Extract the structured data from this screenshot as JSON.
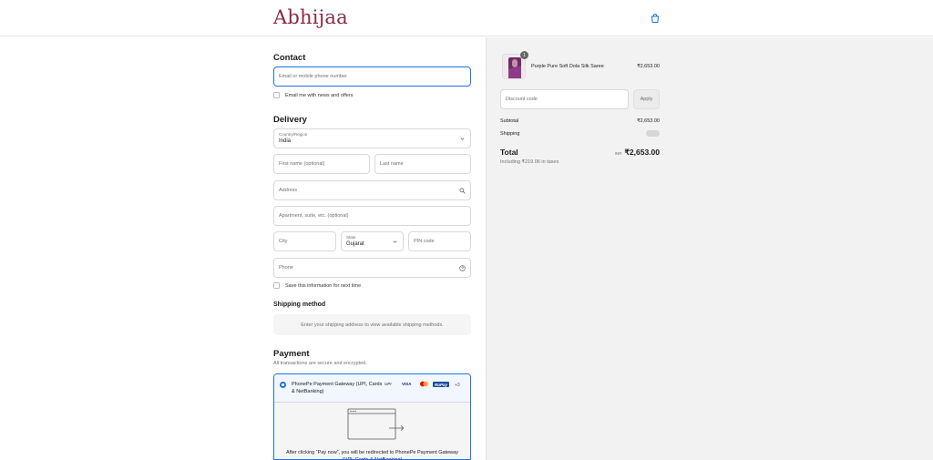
{
  "header": {
    "logo": "Abhijaa",
    "cart_icon": "shopping-bag-icon",
    "accent_color": "#8a2a45"
  },
  "contact": {
    "title": "Contact",
    "email_placeholder": "Email or mobile phone number",
    "newsletter_label": "Email me with news and offers"
  },
  "delivery": {
    "title": "Delivery",
    "country_label": "Country/Region",
    "country_value": "India",
    "first_name_placeholder": "First name (optional)",
    "last_name_placeholder": "Last name",
    "address_placeholder": "Address",
    "apartment_placeholder": "Apartment, suite, etc. (optional)",
    "city_placeholder": "City",
    "state_label": "State",
    "state_value": "Gujarat",
    "pin_placeholder": "PIN code",
    "phone_placeholder": "Phone",
    "save_info_label": "Save this information for next time"
  },
  "shipping_method": {
    "title": "Shipping method",
    "message": "Enter your shipping address to view available shipping methods."
  },
  "payment": {
    "title": "Payment",
    "subtitle": "All transactions are secure and encrypted.",
    "option_label": "PhonePe Payment Gateway (UPI, Cards & NetBanking)",
    "logos": [
      "UPI",
      "VISA",
      "mastercard",
      "RuPay"
    ],
    "more": "+3",
    "redirect_text": "After clicking “Pay now”, you will be redirected to PhonePe Payment Gateway (UPI, Cards & NetBanking)"
  },
  "summary": {
    "product": {
      "name": "Purple Pure Soft Dola Silk Saree",
      "price": "₹2,653.00",
      "quantity": "1"
    },
    "discount_placeholder": "Discount code",
    "apply_label": "Apply",
    "subtotal_label": "Subtotal",
    "subtotal_value": "₹2,653.00",
    "shipping_label": "Shipping",
    "total_label": "Total",
    "currency": "INR",
    "total_value": "₹2,653.00",
    "tax_note": "Including ₹219.06 in taxes"
  },
  "colors": {
    "focus_blue": "#1a73e8",
    "summary_bg": "#f2f2f2"
  }
}
